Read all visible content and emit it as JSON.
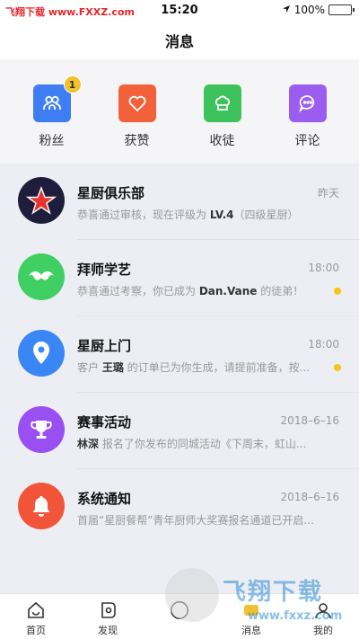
{
  "status_bar": {
    "watermark": "飞翔下载 www.FXXZ.com",
    "time": "15:20",
    "battery": "100%",
    "battery_level": 1.0
  },
  "header": {
    "title": "消息"
  },
  "quick_actions": [
    {
      "label": "粉丝",
      "icon": "fans-icon",
      "color": "#3f7ef2",
      "badge": "1"
    },
    {
      "label": "获赞",
      "icon": "heart-icon",
      "color": "#f2623a"
    },
    {
      "label": "收徒",
      "icon": "chef-hat-icon",
      "color": "#3ec25c"
    },
    {
      "label": "评论",
      "icon": "comment-icon",
      "color": "#9b5cf0"
    }
  ],
  "messages": [
    {
      "title": "星厨俱乐部",
      "time": "昨天",
      "pre": "恭喜通过审核，现在评级为 ",
      "bold": "LV.4",
      "post": "（四级星厨）",
      "unread": false,
      "icon": "star-icon",
      "color": "#1e1e3c"
    },
    {
      "title": "拜师学艺",
      "time": "18:00",
      "pre": "恭喜通过考察，你已成为 ",
      "bold": "Dan.Vane",
      "post": " 的徒弟！",
      "unread": true,
      "icon": "mustache-icon",
      "color": "#3fcf62"
    },
    {
      "title": "星厨上门",
      "time": "18:00",
      "pre": "客户 ",
      "bold": "王璐",
      "post": " 的订单已为你生成，请提前准备，按...",
      "unread": true,
      "icon": "location-pin-icon",
      "color": "#3a86f4"
    },
    {
      "title": "赛事活动",
      "time": "2018–6–16",
      "pre": "",
      "bold": "林深",
      "post": " 报名了你发布的同城活动《下周末，虹山...",
      "unread": false,
      "icon": "trophy-icon",
      "color": "#9a4ff2"
    },
    {
      "title": "系统通知",
      "time": "2018–6–16",
      "pre": "首届“星厨餐帮”青年厨师大奖赛报名通道已开启...",
      "bold": "",
      "post": "",
      "unread": false,
      "icon": "bell-icon",
      "color": "#f2543a"
    }
  ],
  "tabs": [
    {
      "label": "首页",
      "icon": "home-icon"
    },
    {
      "label": "发现",
      "icon": "discover-icon"
    },
    {
      "label": "",
      "icon": "publish-icon"
    },
    {
      "label": "消息",
      "icon": "message-icon"
    },
    {
      "label": "我的",
      "icon": "profile-icon"
    }
  ],
  "watermark_bottom": {
    "title": "飞翔下载",
    "url": "www.fxxz.com"
  }
}
